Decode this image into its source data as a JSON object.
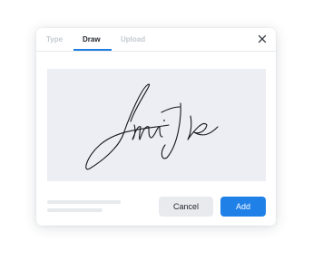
{
  "dialog": {
    "tabs": [
      {
        "label": "Type",
        "active": false
      },
      {
        "label": "Draw",
        "active": true
      },
      {
        "label": "Upload",
        "active": false
      }
    ],
    "close_icon": "close-icon",
    "signature_icon": "handwritten-signature",
    "cancel_label": "Cancel",
    "add_label": "Add"
  },
  "colors": {
    "accent": "#1f80e8",
    "canvas_background": "#eceef3",
    "cancel_background": "#e8eaee",
    "active_tab_text": "#23272f",
    "inactive_tab_text": "#c4c9d1"
  }
}
